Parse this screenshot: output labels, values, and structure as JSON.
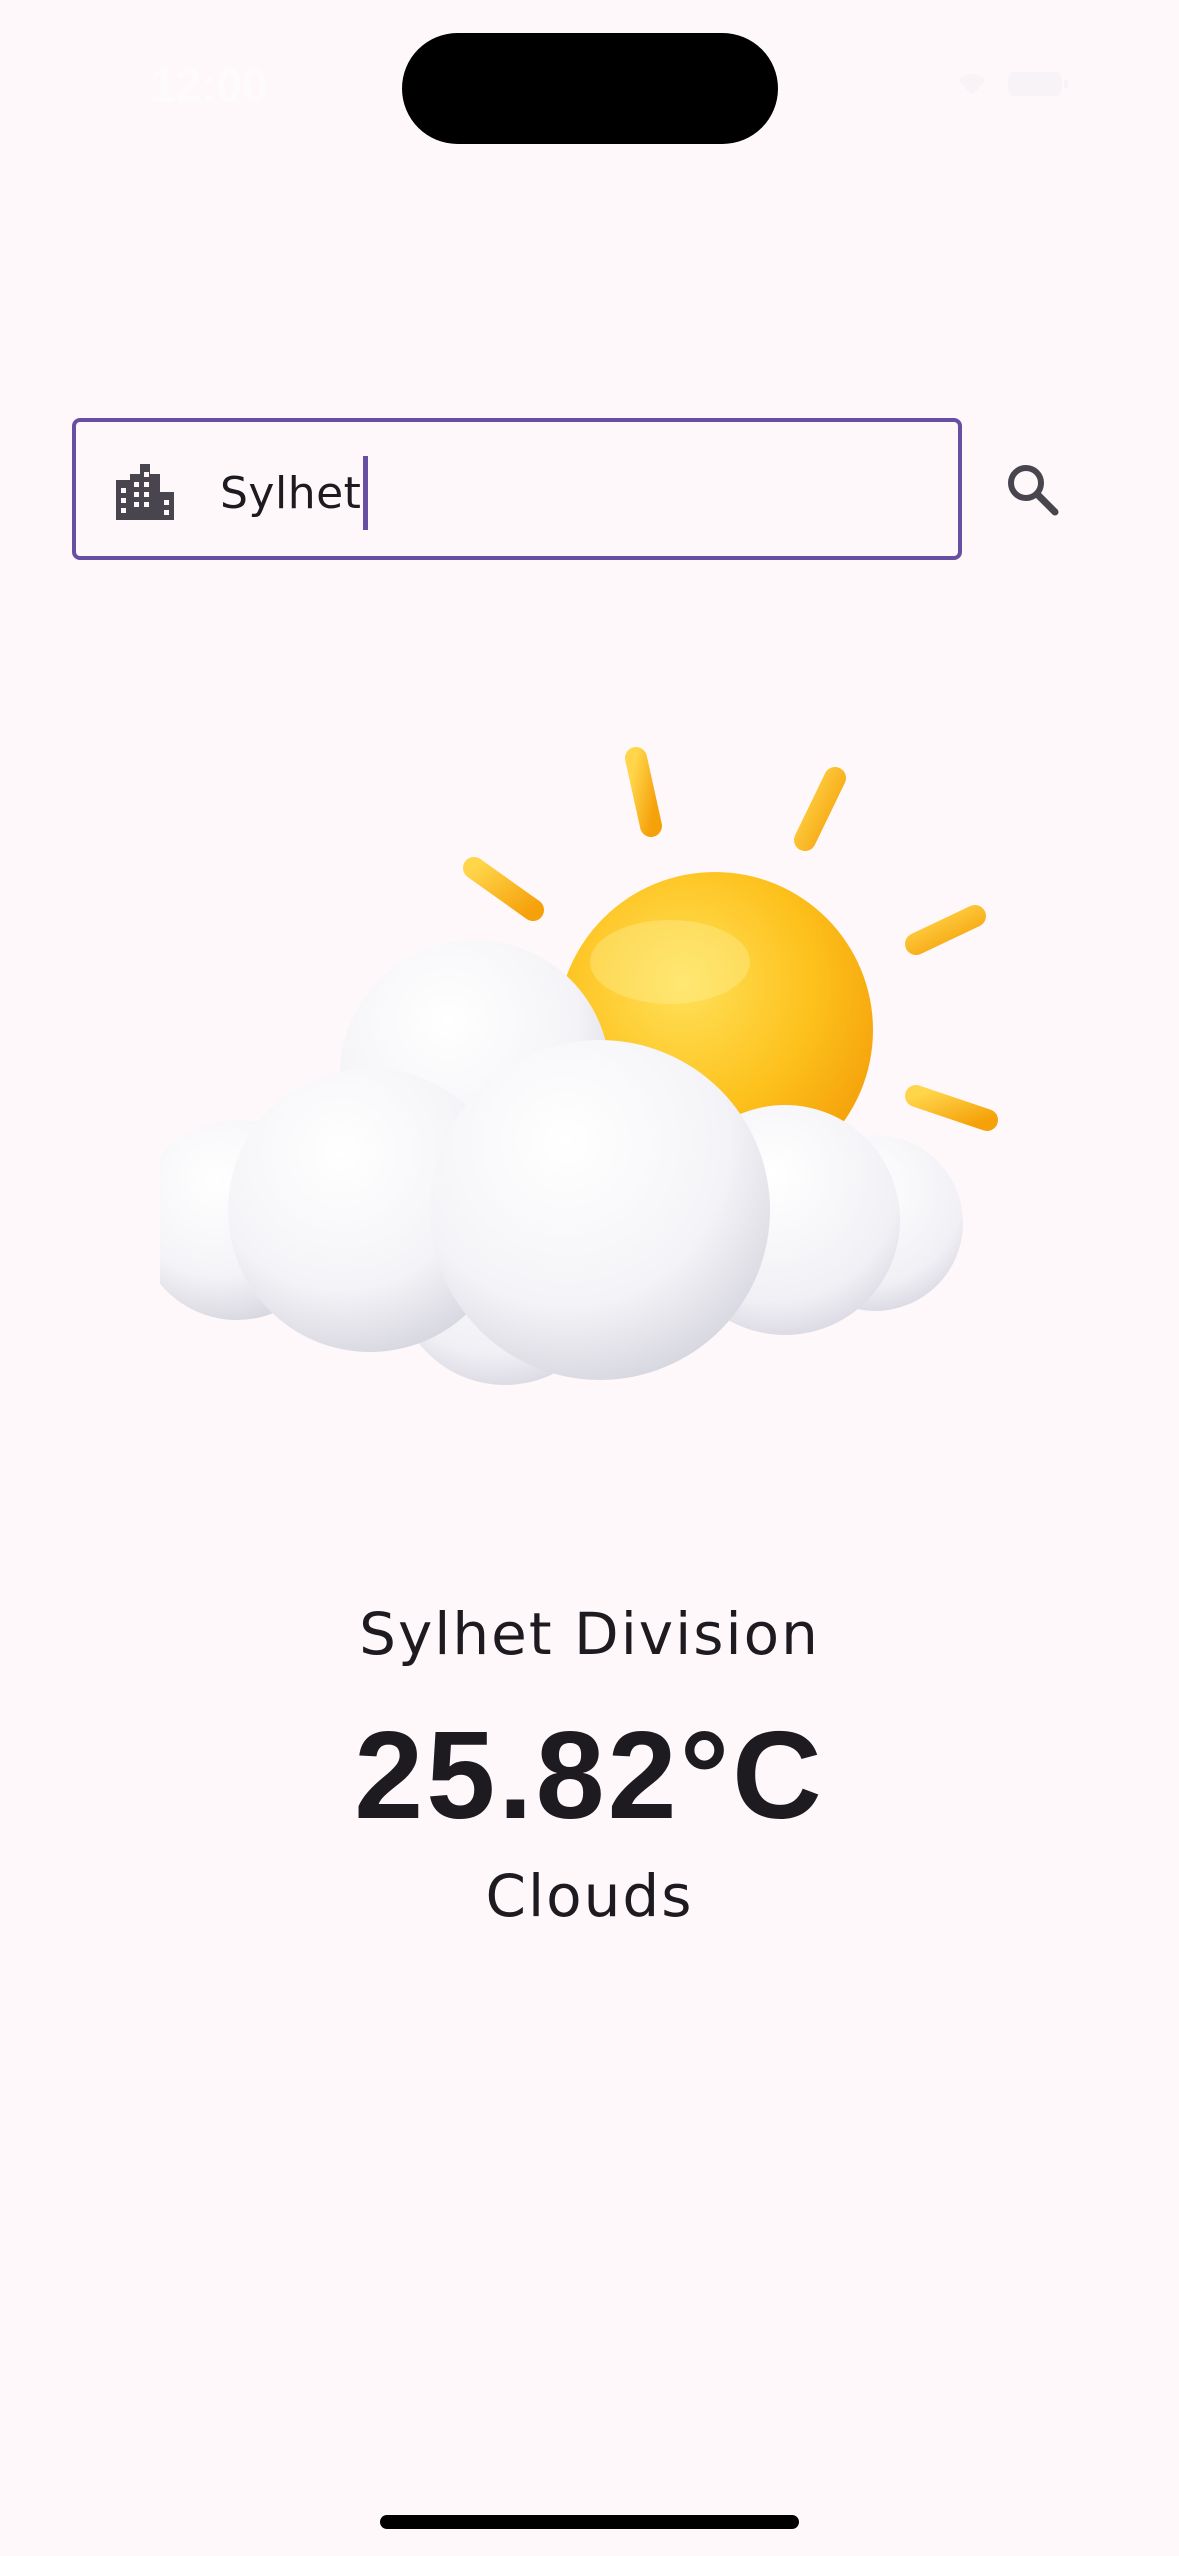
{
  "status_bar": {
    "time": "12:00"
  },
  "search": {
    "value": "Sylhet",
    "leading_icon": "location-city-icon",
    "action_icon": "search-icon",
    "border_color": "#6750a4"
  },
  "weather": {
    "icon": "partly-cloudy-sun-icon",
    "location": "Sylhet Division",
    "temperature": "25.82°C",
    "condition": "Clouds"
  },
  "colors": {
    "background": "#fef8fb",
    "text": "#1d1b20",
    "accent": "#6750a4",
    "sun": "#fbb814"
  }
}
